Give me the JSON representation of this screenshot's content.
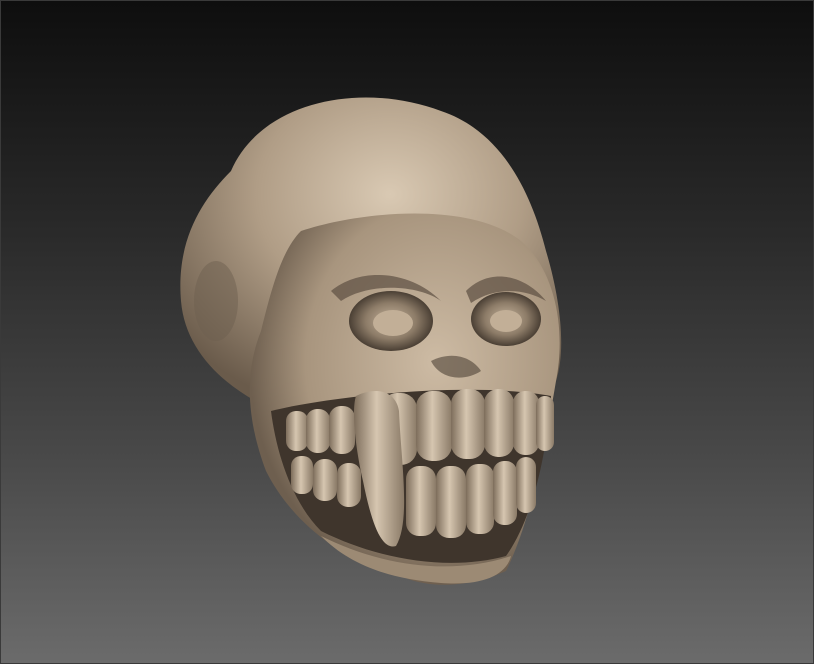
{
  "viewport": {
    "subject": "sculpted-skull-model",
    "colors": {
      "material": "#b3a18b",
      "highlight": "#ddcdb8",
      "shadow": "#4e4337",
      "background_top": "#0e0e0e",
      "background_bottom": "#6b6b6b"
    }
  }
}
